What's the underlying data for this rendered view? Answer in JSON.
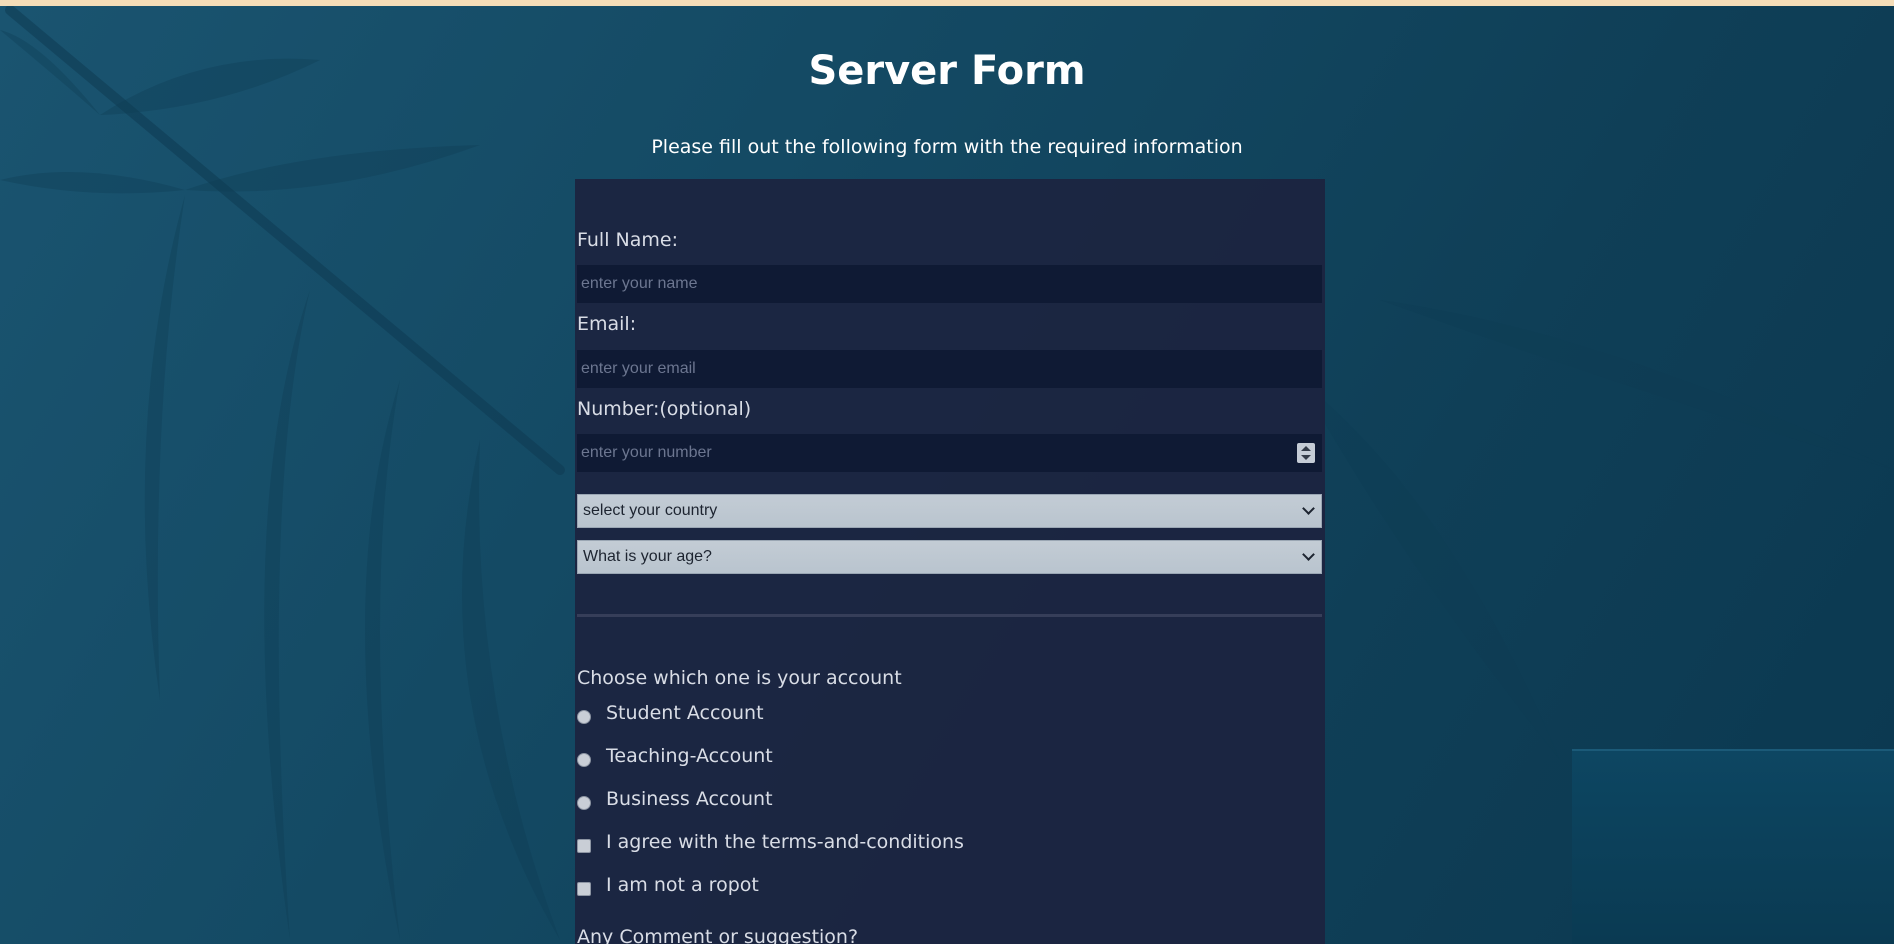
{
  "page": {
    "title": "Server Form",
    "subtitle": "Please fill out the following form with the required information"
  },
  "form": {
    "full_name": {
      "label": "Full Name:",
      "placeholder": "enter your name"
    },
    "email": {
      "label": "Email:",
      "placeholder": "enter your email"
    },
    "number": {
      "label": "Number:(optional)",
      "placeholder": "enter your number"
    },
    "country_select": {
      "selected": "select your country"
    },
    "age_select": {
      "selected": "What is your age?"
    },
    "account_question": "Choose which one is your account",
    "account_options": [
      {
        "label": "Student Account"
      },
      {
        "label": "Teaching-Account"
      },
      {
        "label": "Business Account"
      }
    ],
    "checkboxes": [
      {
        "label": "I agree with the terms-and-conditions"
      },
      {
        "label": "I am not a ropot"
      }
    ],
    "comment_label": "Any Comment or suggestion?"
  },
  "colors": {
    "background": "#15465f",
    "panel": "#1c2340",
    "input_bg": "#0f1a34",
    "topbar": "#f5ddb8"
  }
}
